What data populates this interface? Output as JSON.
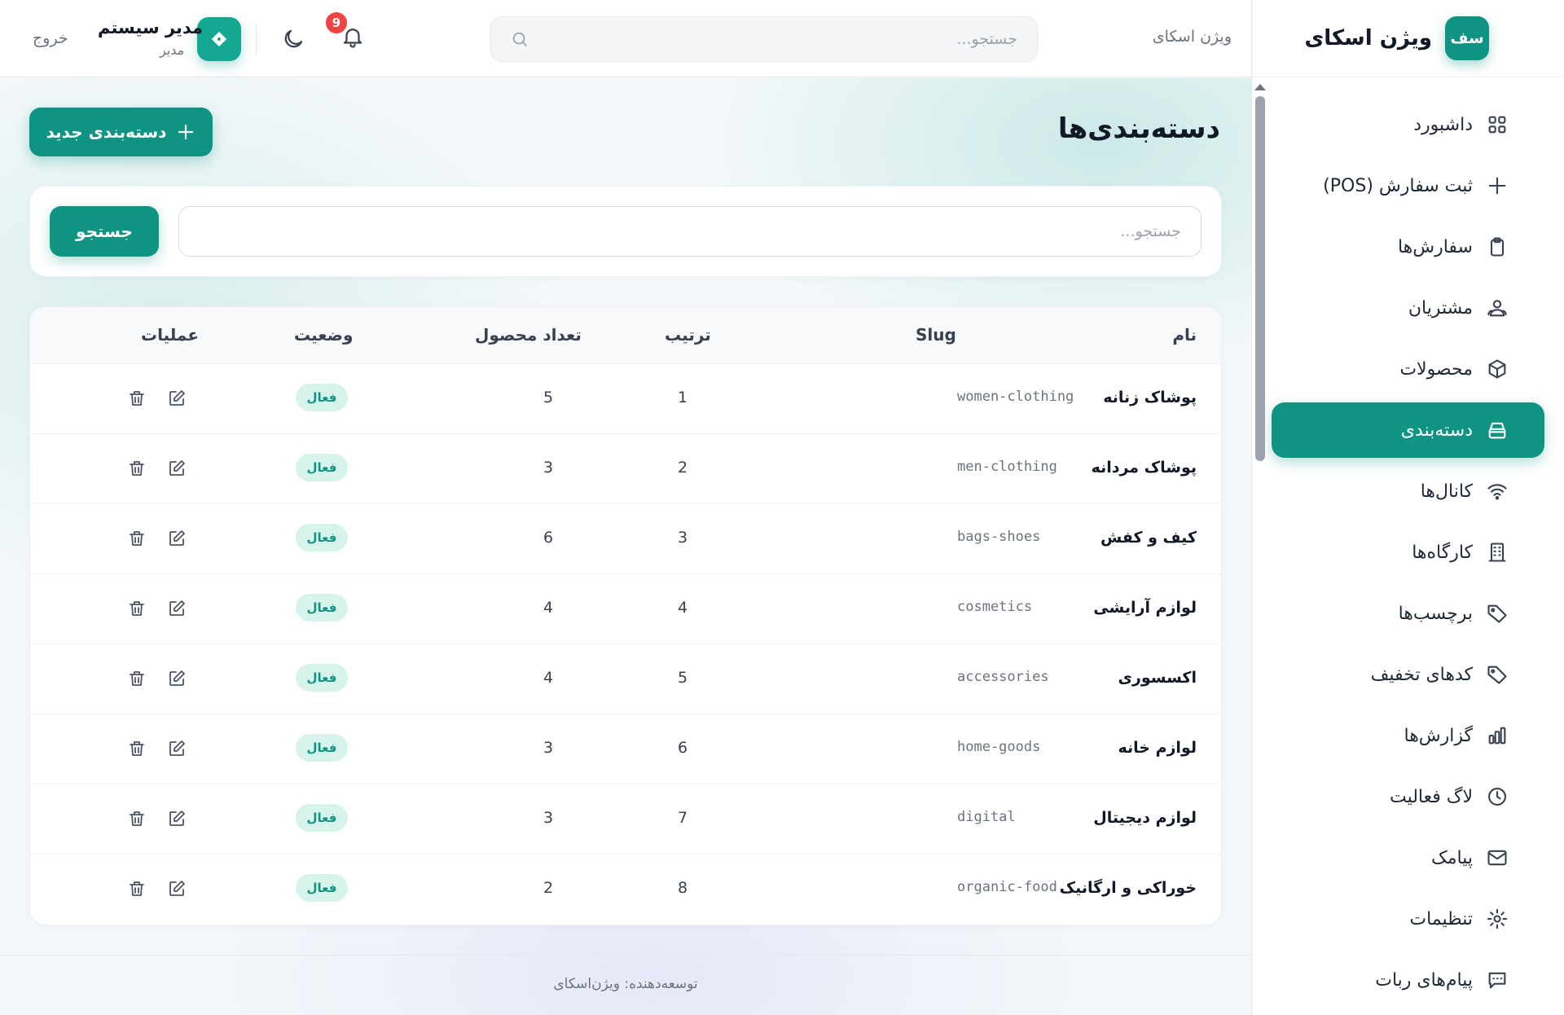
{
  "brand": {
    "logo_text": "سف",
    "name": "ویژن اسکای"
  },
  "nav": [
    {
      "label": "داشبورد",
      "icon": "grid-icon",
      "active": false
    },
    {
      "label": "ثبت سفارش (POS)",
      "icon": "plus-icon",
      "active": false
    },
    {
      "label": "سفارش‌ها",
      "icon": "clipboard-icon",
      "active": false
    },
    {
      "label": "مشتریان",
      "icon": "users-icon",
      "active": false
    },
    {
      "label": "محصولات",
      "icon": "box-icon",
      "active": false
    },
    {
      "label": "دسته‌بندی",
      "icon": "tray-icon",
      "active": true
    },
    {
      "label": "کانال‌ها",
      "icon": "wifi-icon",
      "active": false
    },
    {
      "label": "کارگاه‌ها",
      "icon": "building-icon",
      "active": false
    },
    {
      "label": "برچسب‌ها",
      "icon": "tag-icon",
      "active": false
    },
    {
      "label": "کدهای تخفیف",
      "icon": "tag-icon",
      "active": false
    },
    {
      "label": "گزارش‌ها",
      "icon": "bar-chart-icon",
      "active": false
    },
    {
      "label": "لاگ فعالیت",
      "icon": "clock-icon",
      "active": false
    },
    {
      "label": "پیامک",
      "icon": "mail-icon",
      "active": false
    },
    {
      "label": "تنظیمات",
      "icon": "gear-icon",
      "active": false
    },
    {
      "label": "پیام‌های ربات",
      "icon": "chat-icon",
      "active": false
    }
  ],
  "topbar": {
    "breadcrumb": "ویژن اسکای",
    "search_placeholder": "جستجو...",
    "notification_count": "9",
    "user_name": "مدیر سیستم",
    "user_role": "مدیر",
    "logout_label": "خروج"
  },
  "page": {
    "title": "دسته‌بندی‌ها",
    "new_button_label": "دسته‌بندی جدید",
    "filter_placeholder": "جستجو...",
    "filter_button_label": "جستجو"
  },
  "table": {
    "headers": {
      "name": "نام",
      "slug": "Slug",
      "order": "ترتیب",
      "product_count": "تعداد محصول",
      "status": "وضعیت",
      "actions": "عملیات"
    },
    "rows": [
      {
        "name": "پوشاک زنانه",
        "slug": "women-clothing",
        "order": "1",
        "count": "5",
        "status": "فعال"
      },
      {
        "name": "پوشاک مردانه",
        "slug": "men-clothing",
        "order": "2",
        "count": "3",
        "status": "فعال"
      },
      {
        "name": "کیف و کفش",
        "slug": "bags-shoes",
        "order": "3",
        "count": "6",
        "status": "فعال"
      },
      {
        "name": "لوازم آرایشی",
        "slug": "cosmetics",
        "order": "4",
        "count": "4",
        "status": "فعال"
      },
      {
        "name": "اکسسوری",
        "slug": "accessories",
        "order": "5",
        "count": "4",
        "status": "فعال"
      },
      {
        "name": "لوازم خانه",
        "slug": "home-goods",
        "order": "6",
        "count": "3",
        "status": "فعال"
      },
      {
        "name": "لوازم دیجیتال",
        "slug": "digital",
        "order": "7",
        "count": "3",
        "status": "فعال"
      },
      {
        "name": "خوراکی و ارگانیک",
        "slug": "organic-food",
        "order": "8",
        "count": "2",
        "status": "فعال"
      }
    ]
  },
  "footer": {
    "text": "توسعه‌دهنده: ویژن‌اسکای"
  },
  "colors": {
    "accent": "#0f9483",
    "badge_bg": "#d6f3ec",
    "danger": "#ef4444"
  }
}
